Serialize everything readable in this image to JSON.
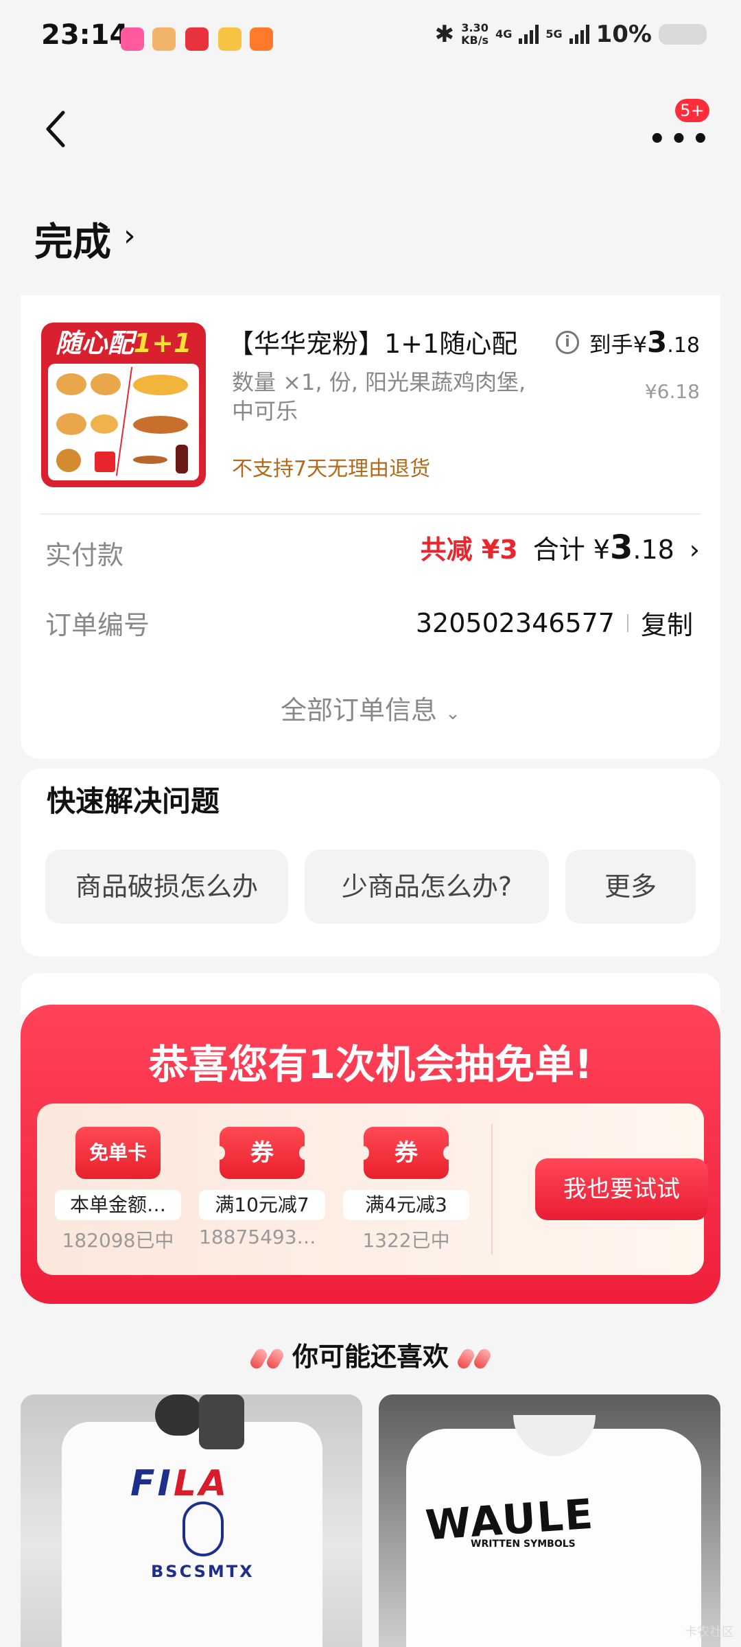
{
  "status_bar": {
    "time": "23:14",
    "speed_value": "3.30",
    "speed_unit": "KB/s",
    "net1": "4G",
    "net2": "5G",
    "battery": "10%"
  },
  "header": {
    "badge": "5+",
    "more_icon": "more-dots-icon"
  },
  "order_status": {
    "title": "完成"
  },
  "product": {
    "name": "【华华宠粉】1+1随心配",
    "desc": "数量 ×1, 份, 阳光果蔬鸡肉堡, 中可乐",
    "notice": "不支持7天无理由退货",
    "thumb_text_a": "随心配",
    "thumb_text_b": "1+1",
    "final_label": "到手",
    "final_currency": "¥",
    "final_int": "3",
    "final_dec": ".18",
    "original": "¥6.18"
  },
  "payment": {
    "label": "实付款",
    "discount": "共减 ¥3",
    "total_label": "合计 ¥",
    "total_int": "3",
    "total_dec": ".18"
  },
  "order_no": {
    "label": "订单编号",
    "value": "320502346577",
    "copy": "复制"
  },
  "all_info": "全部订单信息",
  "quick_help": {
    "title": "快速解决问题",
    "buttons": [
      "商品破损怎么办",
      "少商品怎么办?",
      "更多"
    ]
  },
  "lottery": {
    "title": "恭喜您有1次机会抽免单!",
    "prizes": [
      {
        "icon": "免单卡",
        "caption": "本单金额…",
        "count": "182098已中"
      },
      {
        "icon": "券",
        "caption": "满10元减7",
        "count": "188754932…"
      },
      {
        "icon": "券",
        "caption": "满4元减3",
        "count": "1322已中"
      }
    ],
    "try_button": "我也要试试"
  },
  "recommend": {
    "title": "你可能还喜欢",
    "item1_logo_a": "FI",
    "item1_logo_b": "LA",
    "item1_sub": "BSCSMTX",
    "item2_logo": "WAULE",
    "item2_sub": "WRITTEN SYMBOLS"
  },
  "watermark": "卡农社区"
}
